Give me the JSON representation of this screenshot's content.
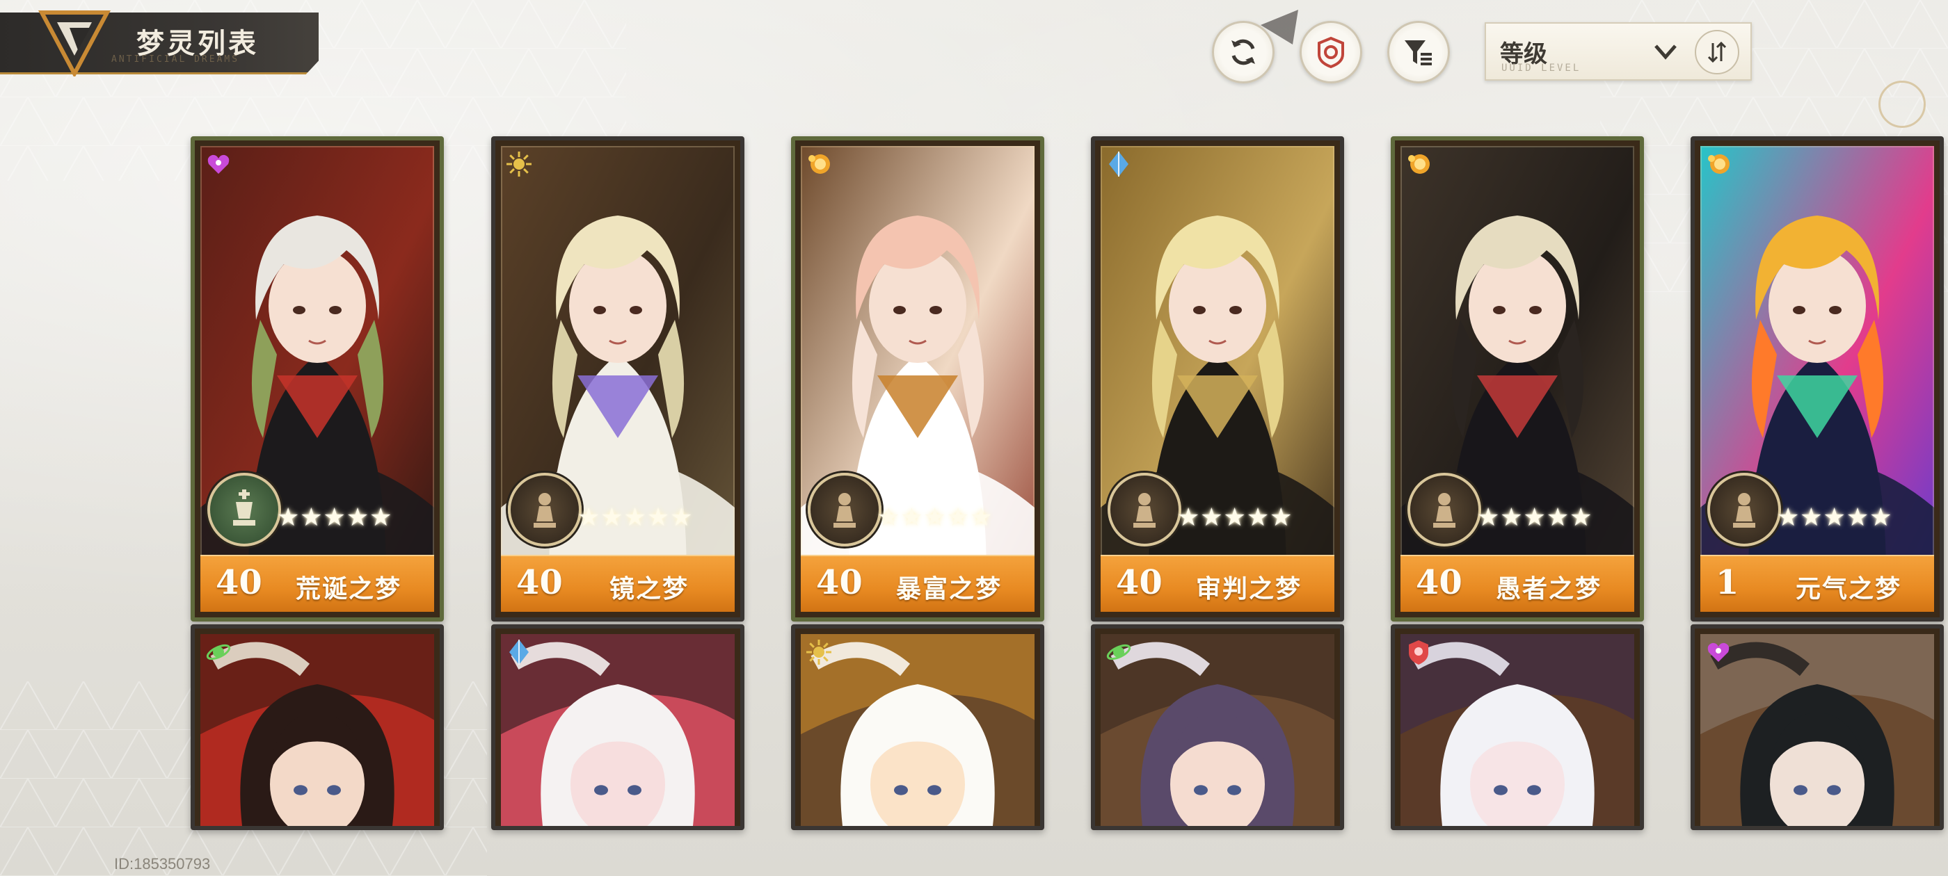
{
  "header": {
    "title": "梦灵列表",
    "subtitle_ghost": "ANTIFICIAL DREAMS"
  },
  "controls": {
    "refresh_icon": "refresh-icon",
    "target_icon": "target-icon",
    "filter_icon": "filter-list-icon",
    "sort": {
      "label": "等级",
      "ghost": "UUID LEVEL",
      "chevron_icon": "chevron-down-icon",
      "order_icon": "sort-order-icon"
    }
  },
  "colors": {
    "card_border_green": "#5f6a3c",
    "card_border_dark": "#3a3633",
    "bar_orange": "#e88a22",
    "badge_green": "#3e5a3a",
    "badge_dark": "#3b2f22"
  },
  "cards_row1": [
    {
      "level": "40",
      "name": "荒诞之梦",
      "stars": "★★★★★",
      "element": "heart-icon",
      "element_color": "#c94ad9",
      "badge": "green"
    },
    {
      "level": "40",
      "name": "镜之梦",
      "stars": "★★★★★",
      "element": "sun-icon",
      "element_color": "#e6c04a",
      "badge": "dark"
    },
    {
      "level": "40",
      "name": "暴富之梦",
      "stars": "★★★★★",
      "element": "coin-icon",
      "element_color": "#f0a52a",
      "badge": "dark"
    },
    {
      "level": "40",
      "name": "审判之梦",
      "stars": "★★★★★",
      "element": "crystal-icon",
      "element_color": "#5aa9e6",
      "badge": "dark"
    },
    {
      "level": "40",
      "name": "愚者之梦",
      "stars": "★★★★★",
      "element": "coin-icon",
      "element_color": "#f0a52a",
      "badge": "dark"
    },
    {
      "level": "1",
      "name": "元气之梦",
      "stars": "★★★★★",
      "element": "coin-icon",
      "element_color": "#f0a52a",
      "badge": "dark"
    }
  ],
  "cards_row2": [
    {
      "element": "orbit-icon",
      "element_color": "#6ad05a"
    },
    {
      "element": "crystal-icon",
      "element_color": "#5aa9e6"
    },
    {
      "element": "sun-icon",
      "element_color": "#e6c04a"
    },
    {
      "element": "orbit-icon",
      "element_color": "#6ad05a"
    },
    {
      "element": "shield-icon",
      "element_color": "#e04848"
    },
    {
      "element": "heart-icon",
      "element_color": "#c94ad9"
    }
  ],
  "footer": {
    "uid": "ID:185350793"
  }
}
